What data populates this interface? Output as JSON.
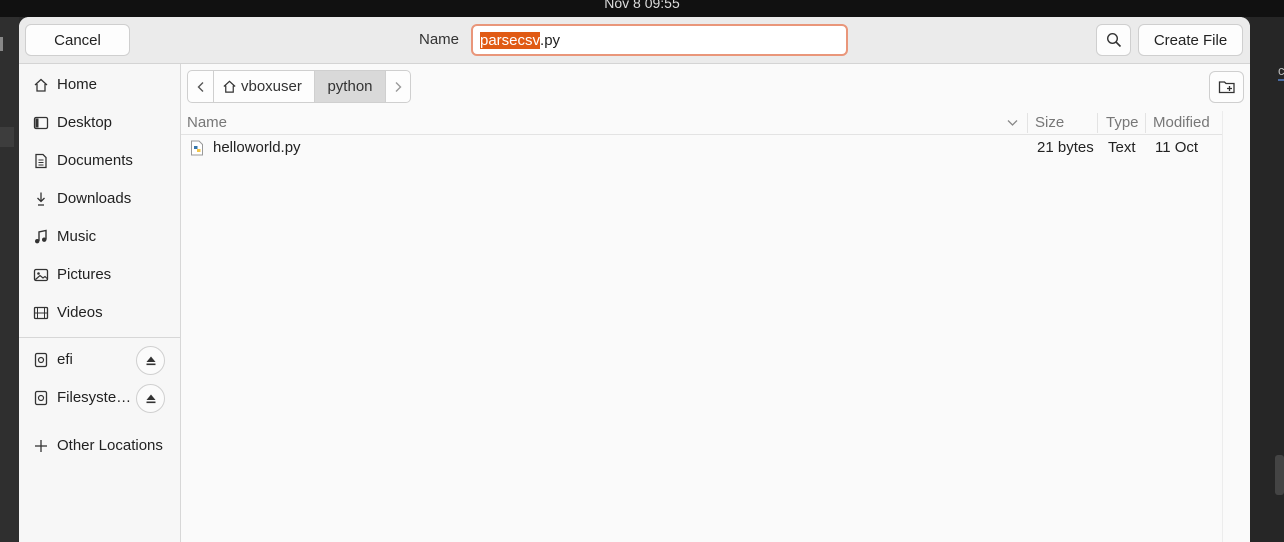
{
  "system": {
    "clock": "Nov 8  09:55"
  },
  "background": {
    "right_fragment_text": "c"
  },
  "header": {
    "cancel_label": "Cancel",
    "name_label": "Name",
    "filename_selected": "parsecsv",
    "filename_rest": ".py",
    "create_label": "Create File"
  },
  "sidebar": {
    "places": [
      {
        "label": "Home",
        "icon": "home-icon"
      },
      {
        "label": "Desktop",
        "icon": "desktop-icon"
      },
      {
        "label": "Documents",
        "icon": "document-icon"
      },
      {
        "label": "Downloads",
        "icon": "download-icon"
      },
      {
        "label": "Music",
        "icon": "music-icon"
      },
      {
        "label": "Pictures",
        "icon": "picture-icon"
      },
      {
        "label": "Videos",
        "icon": "video-icon"
      }
    ],
    "devices": [
      {
        "label": "efi",
        "icon": "drive-icon"
      },
      {
        "label": "Filesyste…",
        "icon": "drive-icon"
      }
    ],
    "other_label": "Other Locations"
  },
  "pathbar": {
    "home_segment": "vboxuser",
    "current_segment": "python"
  },
  "columns": {
    "name": "Name",
    "size": "Size",
    "type": "Type",
    "modified": "Modified"
  },
  "files": [
    {
      "name": "helloworld.py",
      "size": "21 bytes",
      "type": "Text",
      "modified": "11 Oct"
    }
  ],
  "colors": {
    "accent": "#e05a14",
    "focus_border": "#e9967a"
  }
}
